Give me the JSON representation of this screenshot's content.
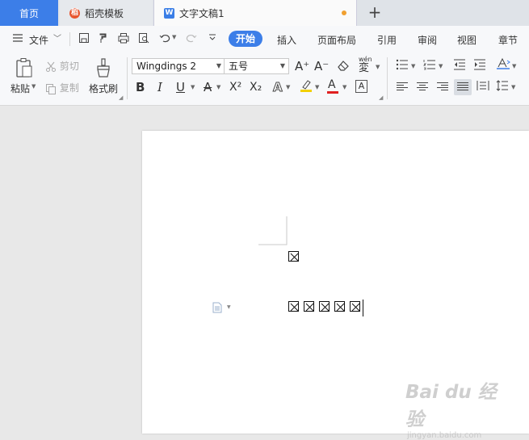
{
  "tabs": {
    "home": "首页",
    "templates": "稻壳模板",
    "document": "文字文稿1"
  },
  "menubar": {
    "file": "文件",
    "start": "开始",
    "insert": "插入",
    "layout": "页面布局",
    "references": "引用",
    "review": "审阅",
    "view": "视图",
    "chapter": "章节"
  },
  "ribbon": {
    "paste": "粘贴",
    "cut": "剪切",
    "copy": "复制",
    "format_painter": "格式刷",
    "font_name": "Wingdings 2",
    "font_size": "五号",
    "increase_font": "A⁺",
    "decrease_font": "A⁻",
    "phonetic": "wén",
    "phonetic_char": "変",
    "bold": "B",
    "italic": "I",
    "underline": "U",
    "strikethrough": "A",
    "superscript": "X²",
    "subscript": "X₂",
    "text_effect": "A",
    "highlight": "A",
    "font_color": "A",
    "char_border": "A"
  },
  "document": {
    "line1_count": 1,
    "line2_count": 5
  },
  "watermark": {
    "logo": "Bai du 经验",
    "url": "jingyan.baidu.com"
  },
  "colors": {
    "accent": "#3c7ee8",
    "unsaved_dot": "#f0a030",
    "templates_icon": "#e8552e",
    "highlight_bar": "#f2d000",
    "font_color_bar": "#e02020"
  }
}
